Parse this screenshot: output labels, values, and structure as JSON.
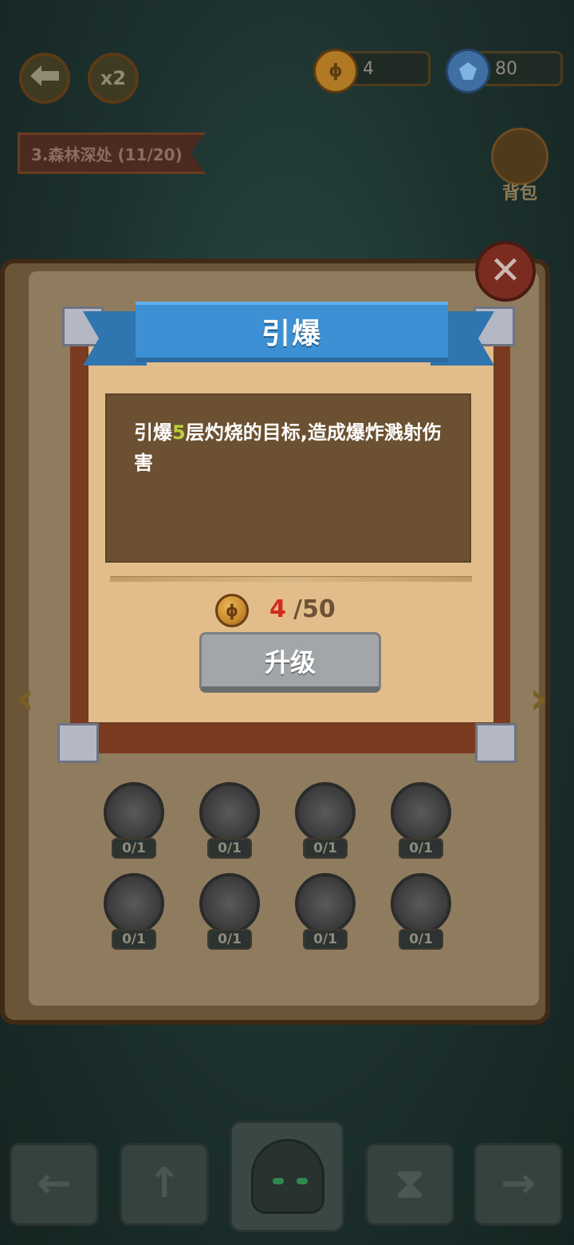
{
  "top_bar": {
    "multiplier_label": "x2",
    "coin_count": "4",
    "gem_count": "80",
    "back_icon": "back-arrow-icon",
    "coin_icon": "coin-icon",
    "gem_icon": "gem-icon"
  },
  "stage": {
    "label": "3.森林深处 (11/20)"
  },
  "bag": {
    "label": "背包"
  },
  "skill_grid": {
    "rows": [
      [
        {
          "count": "0/1",
          "icon": "fire-orb-icon"
        },
        {
          "count": "0/1",
          "icon": "cross-icon"
        },
        {
          "count": "0/1",
          "icon": "triangle-rune-icon"
        },
        {
          "count": "0/1",
          "icon": "crystal-icon"
        }
      ],
      [
        {
          "count": "0/1",
          "icon": "swirl-icon"
        },
        {
          "count": "0/1",
          "icon": "snowflake-icon"
        },
        {
          "count": "0/1",
          "icon": "pyramid-icon"
        },
        {
          "count": "0/1",
          "icon": "silhouette-icon"
        }
      ]
    ]
  },
  "modal": {
    "title": "引爆",
    "description_prefix": "引爆",
    "description_highlight": "5",
    "description_suffix": "层灼烧的目标,造成爆炸溅射伤害",
    "cost_current": "4",
    "cost_max": "/50",
    "upgrade_label": "升级",
    "close_icon": "close-icon"
  },
  "colors": {
    "ribbon": "#3c90d3",
    "panel": "#e2bd8b",
    "desc_bg": "#6b5131",
    "highlight": "#b9cf3a",
    "cost_current": "#d32b1e",
    "upgrade_button": "#a3a6a8"
  }
}
